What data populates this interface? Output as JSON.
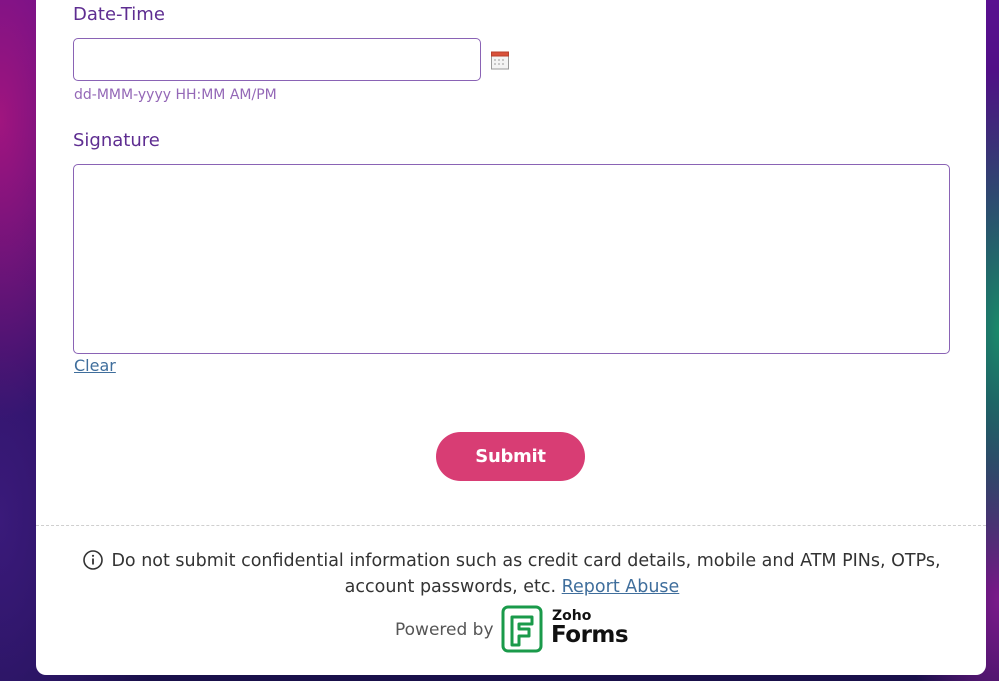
{
  "form": {
    "datetime": {
      "label": "Date-Time",
      "value": "",
      "format_hint": "dd-MMM-yyyy HH:MM AM/PM",
      "icon": "calendar-icon"
    },
    "signature": {
      "label": "Signature",
      "clear_label": "Clear"
    },
    "submit_label": "Submit"
  },
  "footer": {
    "notice_text": "Do not submit confidential information such as credit card details, mobile and ATM PINs, OTPs, account passwords, etc.",
    "report_abuse_label": "Report Abuse",
    "powered_by": "Powered by",
    "brand_top": "Zoho",
    "brand_main": "Forms"
  },
  "colors": {
    "label": "#5e2d91",
    "submit_bg": "#d83d74",
    "link": "#3f6e9c",
    "brand_green": "#1a9a4a"
  }
}
